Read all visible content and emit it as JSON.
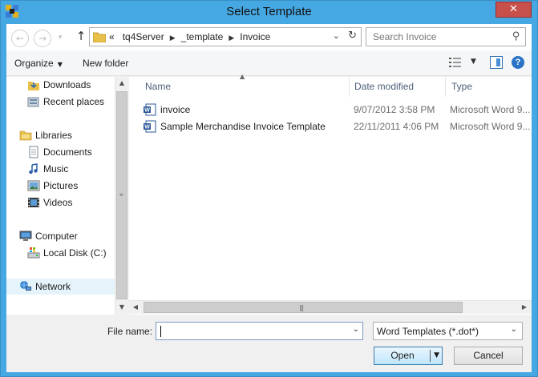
{
  "window": {
    "title": "Select Template",
    "close_label": "✕",
    "app_icon": "template-app-icon"
  },
  "nav": {
    "back_icon": "back-arrow-icon",
    "forward_icon": "forward-arrow-icon",
    "up_icon": "up-arrow-icon",
    "address": {
      "overflow": "«",
      "segments": [
        "tq4Server",
        "_template",
        "Invoice"
      ]
    },
    "search_placeholder": "Search Invoice"
  },
  "toolbar": {
    "organize_label": "Organize",
    "new_folder_label": "New folder"
  },
  "sidebar": {
    "items": [
      {
        "label": "Downloads",
        "icon": "downloads-folder-icon"
      },
      {
        "label": "Recent places",
        "icon": "recent-places-icon"
      },
      {
        "label": "Libraries",
        "icon": "libraries-icon"
      },
      {
        "label": "Documents",
        "icon": "documents-icon"
      },
      {
        "label": "Music",
        "icon": "music-icon"
      },
      {
        "label": "Pictures",
        "icon": "pictures-icon"
      },
      {
        "label": "Videos",
        "icon": "videos-icon"
      },
      {
        "label": "Computer",
        "icon": "computer-icon"
      },
      {
        "label": "Local Disk (C:)",
        "icon": "local-disk-icon"
      },
      {
        "label": "Network",
        "icon": "network-icon"
      }
    ]
  },
  "file_list": {
    "columns": {
      "name": "Name",
      "date": "Date modified",
      "type": "Type"
    },
    "rows": [
      {
        "name": "invoice",
        "date": "9/07/2012 3:58 PM",
        "type": "Microsoft Word 9..."
      },
      {
        "name": "Sample Merchandise Invoice Template",
        "date": "22/11/2011 4:06 PM",
        "type": "Microsoft Word 9..."
      }
    ]
  },
  "bottom": {
    "file_name_label": "File name:",
    "file_name_value": "",
    "file_type_value": "Word Templates (*.dot*)",
    "open_label": "Open",
    "cancel_label": "Cancel"
  },
  "colors": {
    "titlebar": "#46a8e3",
    "close": "#c7504a",
    "accent": "#2b73c5"
  }
}
